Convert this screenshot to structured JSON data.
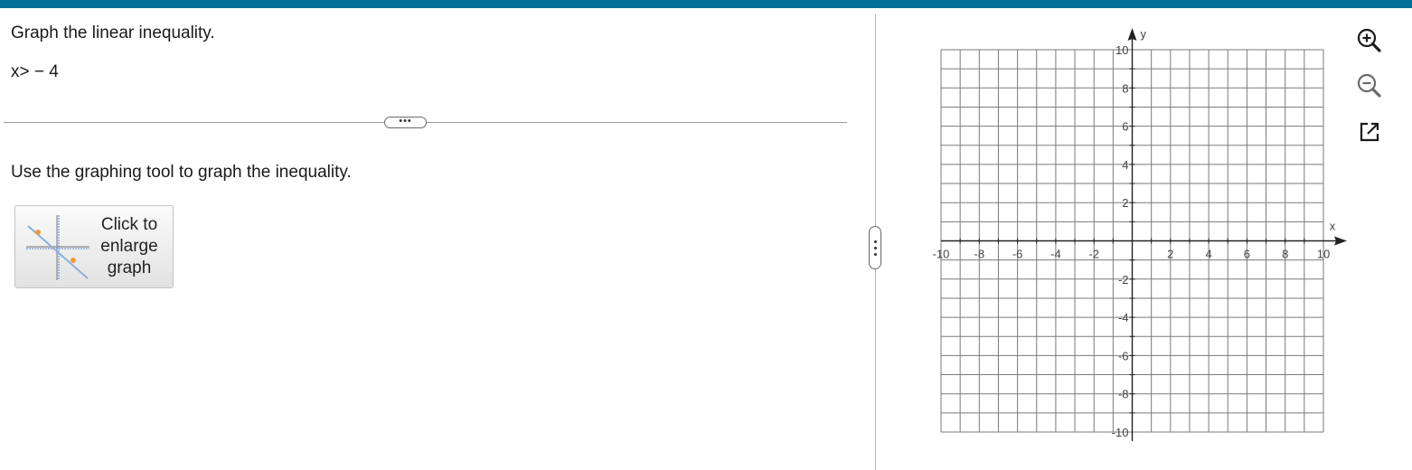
{
  "header": {
    "accent_color": "#007198"
  },
  "question": {
    "title": "Graph the linear inequality.",
    "inequality": "x> − 4",
    "expand_label": "•••",
    "instruction": "Use the graphing tool to graph the inequality.",
    "enlarge_button": {
      "line1": "Click to",
      "line2": "enlarge",
      "line3": "graph",
      "icon": "graph-thumbnail-icon"
    }
  },
  "graph": {
    "x_axis_label": "x",
    "y_axis_label": "y",
    "x_range": [
      -10,
      10
    ],
    "y_range": [
      -10,
      10
    ],
    "grid_step": 1,
    "x_tick_labels": [
      "-10",
      "-8",
      "-6",
      "-4",
      "-2",
      "2",
      "4",
      "6",
      "8",
      "10"
    ],
    "y_tick_labels": [
      "10",
      "8",
      "6",
      "4",
      "2",
      "-2",
      "-4",
      "-6",
      "-8",
      "-10"
    ],
    "grid_color": "#7a7a7a"
  },
  "toolbar": {
    "zoom_in_icon": "zoom-in-icon",
    "zoom_out_icon": "zoom-out-icon",
    "popout_icon": "popout-icon"
  }
}
